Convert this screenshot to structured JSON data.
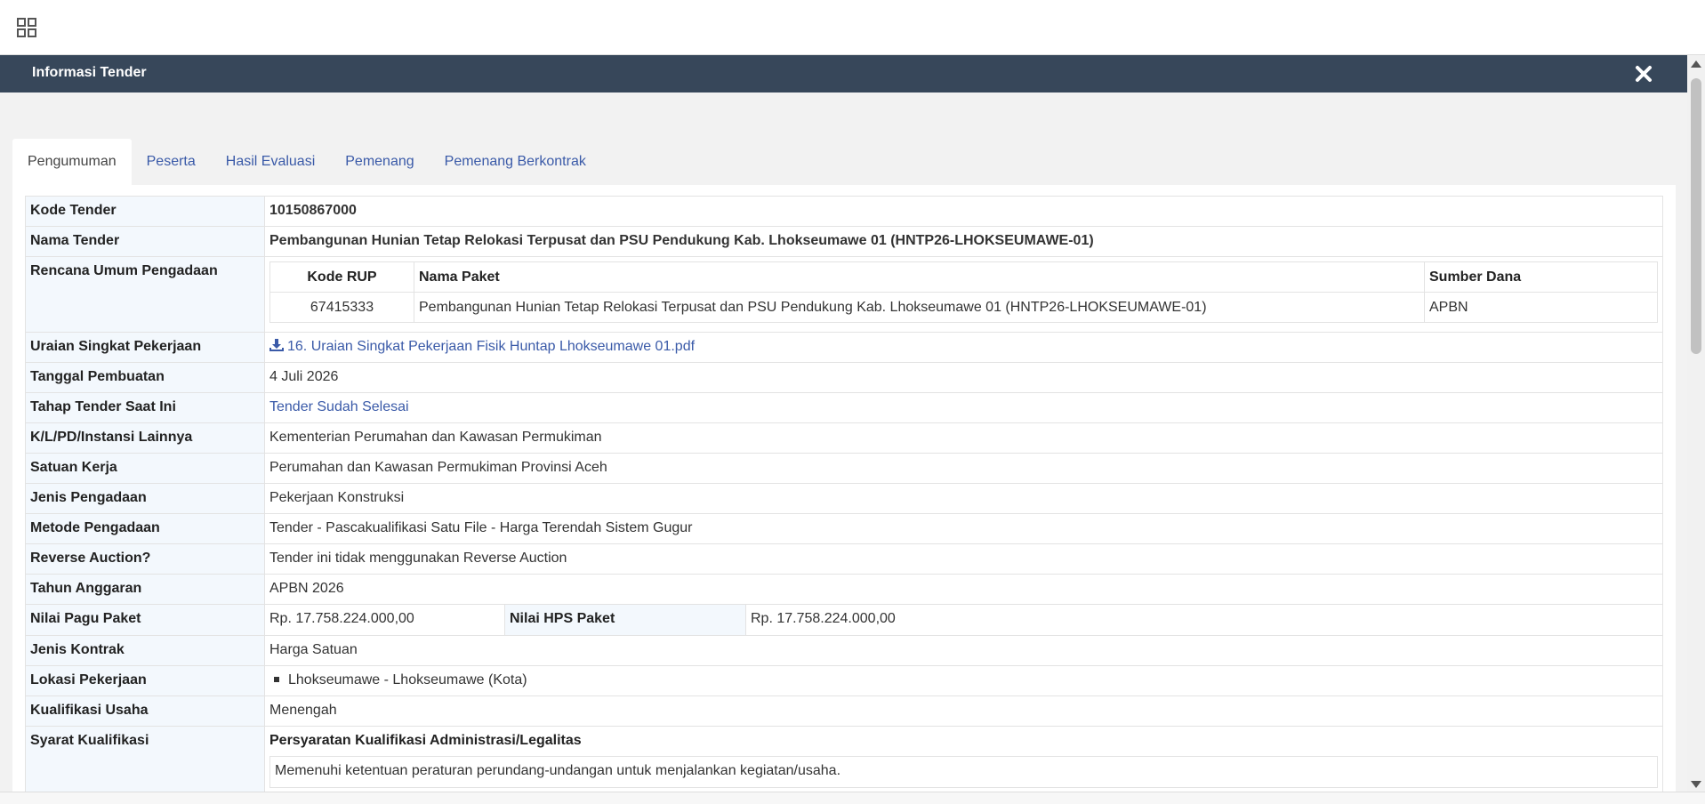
{
  "modal": {
    "title": "Informasi Tender"
  },
  "tabs": [
    "Pengumuman",
    "Peserta",
    "Hasil Evaluasi",
    "Pemenang",
    "Pemenang Berkontrak"
  ],
  "labels": {
    "kode_tender": "Kode Tender",
    "nama_tender": "Nama Tender",
    "rup": "Rencana Umum Pengadaan",
    "uraian": "Uraian Singkat Pekerjaan",
    "tanggal": "Tanggal Pembuatan",
    "tahap": "Tahap Tender Saat Ini",
    "klpd": "K/L/PD/Instansi Lainnya",
    "satker": "Satuan Kerja",
    "jenis_pengadaan": "Jenis Pengadaan",
    "metode": "Metode Pengadaan",
    "reverse": "Reverse Auction?",
    "tahun": "Tahun Anggaran",
    "pagu": "Nilai Pagu Paket",
    "hps": "Nilai HPS Paket",
    "kontrak": "Jenis Kontrak",
    "lokasi": "Lokasi Pekerjaan",
    "kualifikasi": "Kualifikasi Usaha",
    "syarat": "Syarat Kualifikasi"
  },
  "values": {
    "kode_tender": "10150867000",
    "nama_tender": "Pembangunan Hunian Tetap Relokasi Terpusat dan PSU Pendukung Kab. Lhokseumawe 01 (HNTP26-LHOKSEUMAWE-01)",
    "uraian_file": "16. Uraian Singkat Pekerjaan Fisik Huntap Lhokseumawe 01.pdf",
    "tanggal": "4 Juli 2026",
    "tahap": "Tender Sudah Selesai",
    "klpd": "Kementerian Perumahan dan Kawasan Permukiman",
    "satker": "Perumahan dan Kawasan Permukiman Provinsi Aceh",
    "jenis_pengadaan": "Pekerjaan Konstruksi",
    "metode": "Tender - Pascakualifikasi Satu File - Harga Terendah Sistem Gugur",
    "reverse": "Tender ini tidak menggunakan Reverse Auction",
    "tahun": "APBN 2026",
    "pagu": "Rp. 17.758.224.000,00",
    "hps": "Rp. 17.758.224.000,00",
    "kontrak": "Harga Satuan",
    "lokasi": "Lhokseumawe - Lhokseumawe (Kota)",
    "kualifikasi": "Menengah",
    "syarat_heading": "Persyaratan Kualifikasi Administrasi/Legalitas",
    "syarat_item": "Memenuhi ketentuan peraturan perundang-undangan untuk menjalankan kegiatan/usaha."
  },
  "rup_table": {
    "headers": [
      "Kode RUP",
      "Nama Paket",
      "Sumber Dana"
    ],
    "row": [
      "67415333",
      "Pembangunan Hunian Tetap Relokasi Terpusat dan PSU Pendukung Kab. Lhokseumawe 01 (HNTP26-LHOKSEUMAWE-01)",
      "APBN"
    ]
  }
}
